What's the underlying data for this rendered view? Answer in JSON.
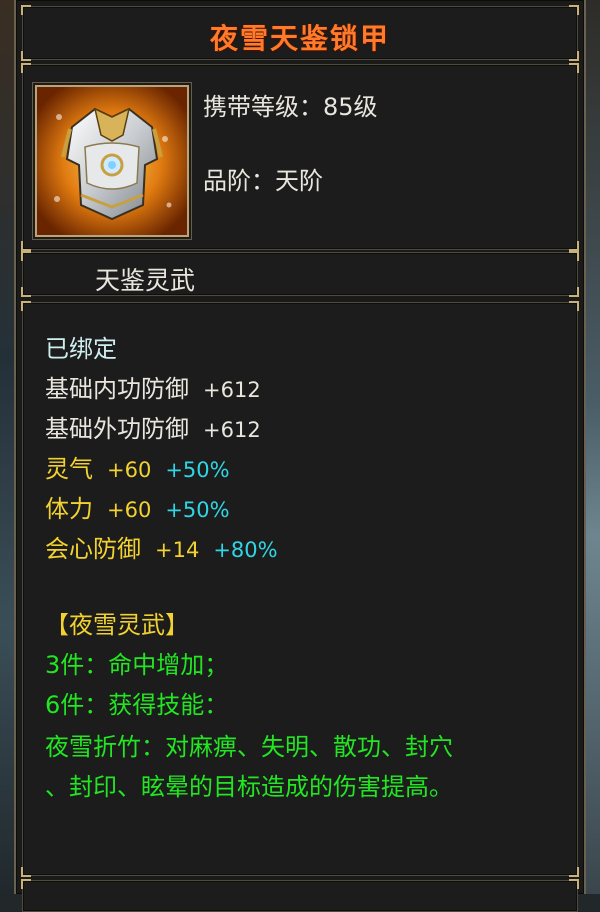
{
  "item": {
    "name": "夜雪天鉴锁甲",
    "required_level_label": "携带等级：",
    "required_level_value": "85级",
    "grade_label": "品阶：",
    "grade_value": "天阶",
    "icon": "armor-chestplate-icon"
  },
  "set_section": {
    "title": "天鉴灵武"
  },
  "stats": {
    "bound": "已绑定",
    "lines": [
      {
        "name": "基础内功防御",
        "value": "+612",
        "bonus": ""
      },
      {
        "name": "基础外功防御",
        "value": "+612",
        "bonus": ""
      },
      {
        "name": "灵气",
        "value": "+60",
        "bonus": "+50%"
      },
      {
        "name": "体力",
        "value": "+60",
        "bonus": "+50%"
      },
      {
        "name": "会心防御",
        "value": "+14",
        "bonus": "+80%"
      }
    ]
  },
  "set_bonus": {
    "title": "【夜雪灵武】",
    "piece3": "3件：命中增加；",
    "piece6": "6件：获得技能：",
    "skill_line1": "夜雪折竹：对麻痹、失明、散功、封穴",
    "skill_line2": "、封印、眩晕的目标造成的伤害提高。"
  },
  "colors": {
    "title": "#ff7a2a",
    "base_stat": "#e9e6de",
    "extra_stat": "#f2d230",
    "percent_bonus": "#2fd6e6",
    "set_effect": "#22e622",
    "frame_gold": "#c9b27a"
  }
}
